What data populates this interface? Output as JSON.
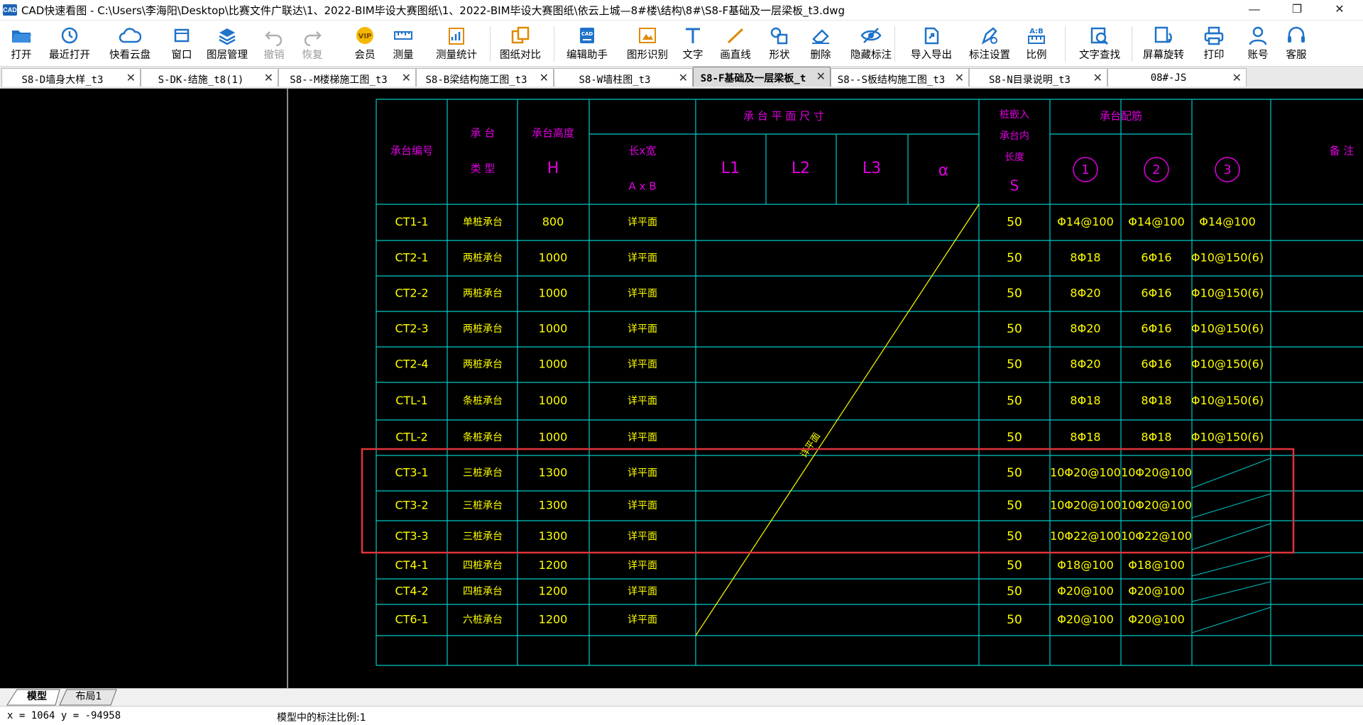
{
  "window": {
    "title": "CAD快速看图 - C:\\Users\\李海阳\\Desktop\\比赛文件广联达\\1、2022-BIM毕设大赛图纸\\1、2022-BIM毕设大赛图纸\\依云上城—8#楼\\结构\\8#\\S8-F基础及一层梁板_t3.dwg",
    "app_icon_text": "CAD",
    "minimize": "—",
    "maximize": "❐",
    "close": "✕"
  },
  "toolbar": [
    {
      "label": "打开",
      "icon": "folder-open-icon"
    },
    {
      "label": "最近打开",
      "icon": "recent-clock-icon"
    },
    {
      "label": "快看云盘",
      "icon": "cloud-icon"
    },
    {
      "label": "窗口",
      "icon": "window-icon"
    },
    {
      "label": "图层管理",
      "icon": "layers-icon"
    },
    {
      "label": "撤销",
      "icon": "undo-icon"
    },
    {
      "label": "恢复",
      "icon": "redo-icon"
    },
    {
      "label": "会员",
      "icon": "vip-icon",
      "badge": "VIP"
    },
    {
      "label": "测量",
      "icon": "ruler-icon"
    },
    {
      "label": "测量统计",
      "icon": "measure-stats-icon"
    },
    {
      "label": "图纸对比",
      "icon": "compare-icon"
    },
    {
      "label": "编辑助手",
      "icon": "edit-assistant-icon",
      "badge": "CAD"
    },
    {
      "label": "图形识别",
      "icon": "shape-recognize-icon"
    },
    {
      "label": "文字",
      "icon": "text-tool-icon"
    },
    {
      "label": "画直线",
      "icon": "line-tool-icon"
    },
    {
      "label": "形状",
      "icon": "shape-tool-icon"
    },
    {
      "label": "删除",
      "icon": "eraser-icon"
    },
    {
      "label": "隐藏标注",
      "icon": "hide-annotation-icon"
    },
    {
      "label": "导入导出",
      "icon": "import-export-icon"
    },
    {
      "label": "标注设置",
      "icon": "annotation-settings-icon"
    },
    {
      "label": "比例",
      "icon": "scale-icon",
      "badge": "A:B"
    },
    {
      "label": "文字查找",
      "icon": "text-search-icon"
    },
    {
      "label": "屏幕旋转",
      "icon": "screen-rotate-icon"
    },
    {
      "label": "打印",
      "icon": "printer-icon"
    },
    {
      "label": "账号",
      "icon": "user-icon"
    },
    {
      "label": "客服",
      "icon": "headset-icon"
    }
  ],
  "tabs": [
    {
      "label": "S8-D墙身大样_t3"
    },
    {
      "label": "S-DK-结施_t8(1)"
    },
    {
      "label": "S8--M楼梯施工图_t3"
    },
    {
      "label": "S8-B梁结构施工图_t3"
    },
    {
      "label": "S8-W墙柱图_t3"
    },
    {
      "label": "S8-F基础及一层梁板_t",
      "active": true
    },
    {
      "label": "S8--S板结构施工图_t3"
    },
    {
      "label": "S8-N目录说明_t3"
    },
    {
      "label": "08#-JS"
    }
  ],
  "tab_close": "✕",
  "drawing": {
    "headers": {
      "id": "承台编号",
      "type1": "承 台",
      "type2": "类 型",
      "height1": "承台高度",
      "height2": "H",
      "plan": "承 台 平 面 尺 寸",
      "lxb1": "长x宽",
      "lxb2": "A x B",
      "l1": "L1",
      "l2": "L2",
      "l3": "L3",
      "alpha": "α",
      "pile1": "桩嵌入",
      "pile2": "承台内",
      "pile3": "长度",
      "pile4": "S",
      "rebar": "承台配筋",
      "r1": "1",
      "r2": "2",
      "r3": "3",
      "note": "备 注"
    },
    "diag_label": "详平面",
    "rows": [
      {
        "id": "CT1-1",
        "type": "单桩承台",
        "h": "800",
        "ab": "详平面",
        "s": "50",
        "r1": "Φ14@100",
        "r2": "Φ14@100",
        "r3": "Φ14@100"
      },
      {
        "id": "CT2-1",
        "type": "两桩承台",
        "h": "1000",
        "ab": "详平面",
        "s": "50",
        "r1": "8Φ18",
        "r2": "6Φ16",
        "r3": "Φ10@150(6)"
      },
      {
        "id": "CT2-2",
        "type": "两桩承台",
        "h": "1000",
        "ab": "详平面",
        "s": "50",
        "r1": "8Φ20",
        "r2": "6Φ16",
        "r3": "Φ10@150(6)"
      },
      {
        "id": "CT2-3",
        "type": "两桩承台",
        "h": "1000",
        "ab": "详平面",
        "s": "50",
        "r1": "8Φ20",
        "r2": "6Φ16",
        "r3": "Φ10@150(6)"
      },
      {
        "id": "CT2-4",
        "type": "两桩承台",
        "h": "1000",
        "ab": "详平面",
        "s": "50",
        "r1": "8Φ20",
        "r2": "6Φ16",
        "r3": "Φ10@150(6)"
      },
      {
        "id": "CTL-1",
        "type": "条桩承台",
        "h": "1000",
        "ab": "详平面",
        "s": "50",
        "r1": "8Φ18",
        "r2": "8Φ18",
        "r3": "Φ10@150(6)"
      },
      {
        "id": "CTL-2",
        "type": "条桩承台",
        "h": "1000",
        "ab": "详平面",
        "s": "50",
        "r1": "8Φ18",
        "r2": "8Φ18",
        "r3": "Φ10@150(6)"
      },
      {
        "id": "CT3-1",
        "type": "三桩承台",
        "h": "1300",
        "ab": "详平面",
        "s": "50",
        "r1": "10Φ20@100",
        "r2": "10Φ20@100",
        "r3": ""
      },
      {
        "id": "CT3-2",
        "type": "三桩承台",
        "h": "1300",
        "ab": "详平面",
        "s": "50",
        "r1": "10Φ20@100",
        "r2": "10Φ20@100",
        "r3": ""
      },
      {
        "id": "CT3-3",
        "type": "三桩承台",
        "h": "1300",
        "ab": "详平面",
        "s": "50",
        "r1": "10Φ22@100",
        "r2": "10Φ22@100",
        "r3": ""
      },
      {
        "id": "CT4-1",
        "type": "四桩承台",
        "h": "1200",
        "ab": "详平面",
        "s": "50",
        "r1": "Φ18@100",
        "r2": "Φ18@100",
        "r3": ""
      },
      {
        "id": "CT4-2",
        "type": "四桩承台",
        "h": "1200",
        "ab": "详平面",
        "s": "50",
        "r1": "Φ20@100",
        "r2": "Φ20@100",
        "r3": ""
      },
      {
        "id": "CT6-1",
        "type": "六桩承台",
        "h": "1200",
        "ab": "详平面",
        "s": "50",
        "r1": "Φ20@100",
        "r2": "Φ20@100",
        "r3": ""
      }
    ],
    "colors": {
      "grid": "#00c8c8",
      "header": "#e000e0",
      "body": "#ffff00",
      "highlight": "#e0343c",
      "vline": "#bbbbbb"
    }
  },
  "layout_tabs": [
    {
      "label": "模型",
      "active": true
    },
    {
      "label": "布局1"
    }
  ],
  "status": {
    "coords": "x = 1064 y = -94958",
    "scale": "模型中的标注比例:1"
  }
}
